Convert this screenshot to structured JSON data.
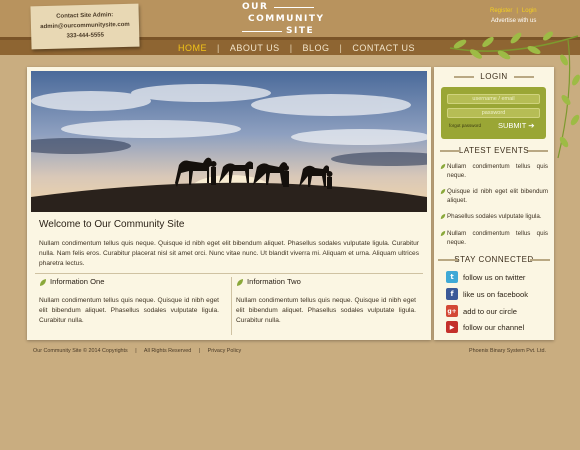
{
  "contact_note": {
    "title": "Contact Site Admin:",
    "email": "admin@ourcommunitysite.com",
    "phone": "333-444-5555"
  },
  "logo": {
    "line1": "OUR",
    "line2": "COMMUNITY",
    "line3": "SITE"
  },
  "top_links": {
    "register": "Register",
    "separator": "|",
    "login": "Login",
    "advertise": "Advertise with us"
  },
  "nav": {
    "items": [
      "HOME",
      "ABOUT US",
      "BLOG",
      "CONTACT US"
    ],
    "separator": "|",
    "active_color": "#f2c418"
  },
  "main": {
    "welcome_title": "Welcome to Our Community Site",
    "welcome_text": "Nullam condimentum tellus quis neque. Quisque id nibh eget elit bibendum aliquet. Phasellus sodales vulputate ligula. Curabitur nulla. Nam felis eros. Curabitur placerat nisl sit amet orci. Nunc vitae nunc. Ut blandit viverra mi. Aliquam et urna. Aliquam ultrices pharetra lectus.",
    "info_one": {
      "title": "Information One",
      "text": "Nullam condimentum tellus quis neque. Quisque id nibh eget elit bibendum aliquet. Phasellus sodales vulputate ligula. Curabitur nulla."
    },
    "info_two": {
      "title": "Information Two",
      "text": "Nullam condimentum tellus quis neque. Quisque id nibh eget elit bibendum aliquet. Phasellus sodales vulputate ligula. Curabitur nulla."
    }
  },
  "sidebar": {
    "login": {
      "heading": "LOGIN",
      "username_placeholder": "username / email",
      "password_placeholder": "password",
      "forgot": "forgot password",
      "submit": "SUBMIT ➔"
    },
    "events": {
      "heading": "LATEST EVENTS",
      "items": [
        "Nullam condimentum tellus quis neque.",
        "Quisque id nibh eget elit bibendum aliquet.",
        "Phasellus sodales vulputate ligula.",
        "Nullam condimentum tellus quis neque."
      ]
    },
    "connected": {
      "heading": "STAY CONNECTED",
      "items": [
        {
          "label": "follow us on twitter",
          "icon": "twitter-icon",
          "glyph": "t",
          "color": "#3fa9d6"
        },
        {
          "label": "like us on facebook",
          "icon": "facebook-icon",
          "glyph": "f",
          "color": "#3b5998"
        },
        {
          "label": "add to our circle",
          "icon": "google-plus-icon",
          "glyph": "g+",
          "color": "#d34836"
        },
        {
          "label": "follow our channel",
          "icon": "youtube-icon",
          "glyph": "▶",
          "color": "#c4302b"
        }
      ]
    }
  },
  "footer": {
    "copyright": "Our Community Site © 2014 Copyrights",
    "rights": "All Rights Reserved",
    "privacy": "Privacy Policy",
    "separator": "|",
    "credit": "Phoenix Binary System Pvt. Ltd."
  },
  "colors": {
    "background": "#c9ad80",
    "nav_band": "#8e6532",
    "card": "#fbf6e3",
    "login_box": "#9aa635",
    "leaf_green": "#8aa83a"
  }
}
